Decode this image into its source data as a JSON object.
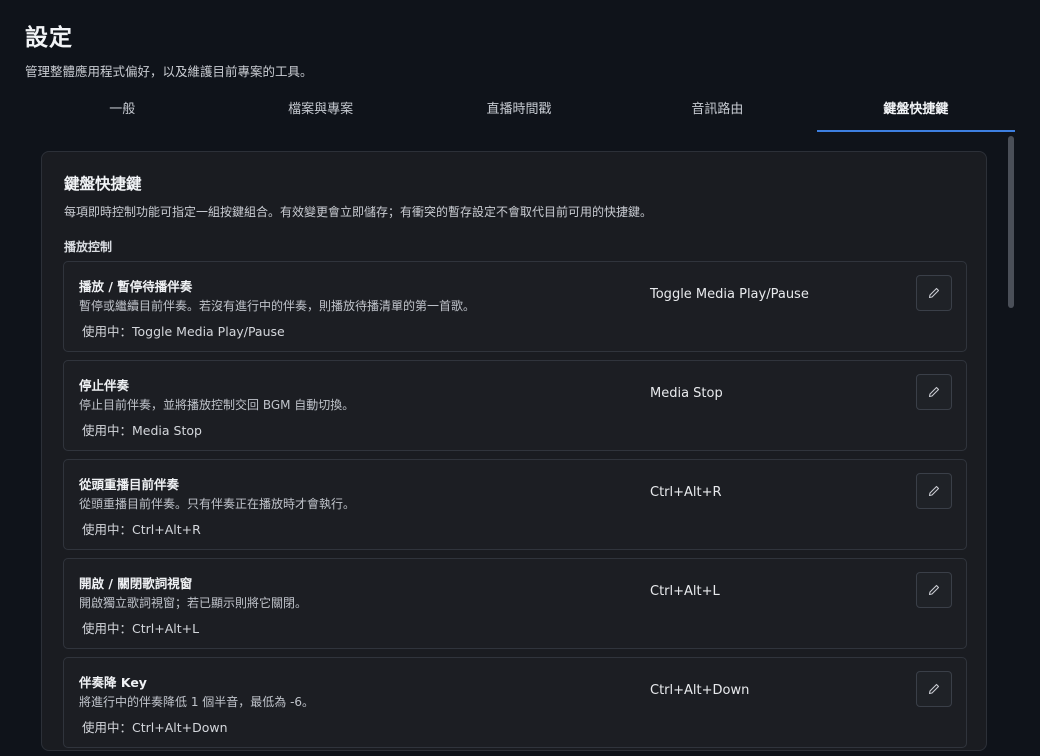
{
  "header": {
    "title": "設定",
    "subtitle": "管理整體應用程式偏好，以及維護目前專案的工具。"
  },
  "tabs": [
    {
      "label": "一般"
    },
    {
      "label": "檔案與專案"
    },
    {
      "label": "直播時間戳"
    },
    {
      "label": "音訊路由"
    },
    {
      "label": "鍵盤快捷鍵",
      "active": true
    }
  ],
  "panel": {
    "title": "鍵盤快捷鍵",
    "description": "每項即時控制功能可指定一組按鍵組合。有效變更會立即儲存；有衝突的暫存設定不會取代目前可用的快捷鍵。",
    "section_title": "播放控制"
  },
  "shortcuts": [
    {
      "title": "播放 / 暫停待播伴奏",
      "description": "暫停或繼續目前伴奏。若沒有進行中的伴奏，則播放待播清單的第一首歌。",
      "active_label": "使用中：Toggle Media Play/Pause",
      "key": "Toggle Media Play/Pause"
    },
    {
      "title": "停止伴奏",
      "description": "停止目前伴奏，並將播放控制交回 BGM 自動切換。",
      "active_label": "使用中：Media Stop",
      "key": "Media Stop"
    },
    {
      "title": "從頭重播目前伴奏",
      "description": "從頭重播目前伴奏。只有伴奏正在播放時才會執行。",
      "active_label": "使用中：Ctrl+Alt+R",
      "key": "Ctrl+Alt+R"
    },
    {
      "title": "開啟 / 關閉歌詞視窗",
      "description": "開啟獨立歌詞視窗；若已顯示則將它關閉。",
      "active_label": "使用中：Ctrl+Alt+L",
      "key": "Ctrl+Alt+L"
    },
    {
      "title": "伴奏降 Key",
      "description": "將進行中的伴奏降低 1 個半音，最低為 -6。",
      "active_label": "使用中：Ctrl+Alt+Down",
      "key": "Ctrl+Alt+Down"
    }
  ],
  "icons": {
    "edit": "pencil-icon"
  },
  "colors": {
    "accent": "#3d7fe0",
    "background": "#0f131a",
    "panel": "#1a1c21"
  }
}
